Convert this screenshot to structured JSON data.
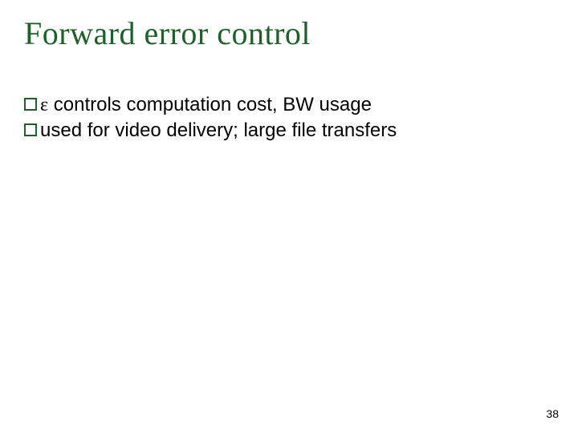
{
  "title": "Forward error control",
  "bullets": [
    {
      "epsilon": "ε",
      "text": " controls computation cost, BW usage"
    },
    {
      "text": "used for video delivery; large file transfers"
    }
  ],
  "page_number": "38"
}
